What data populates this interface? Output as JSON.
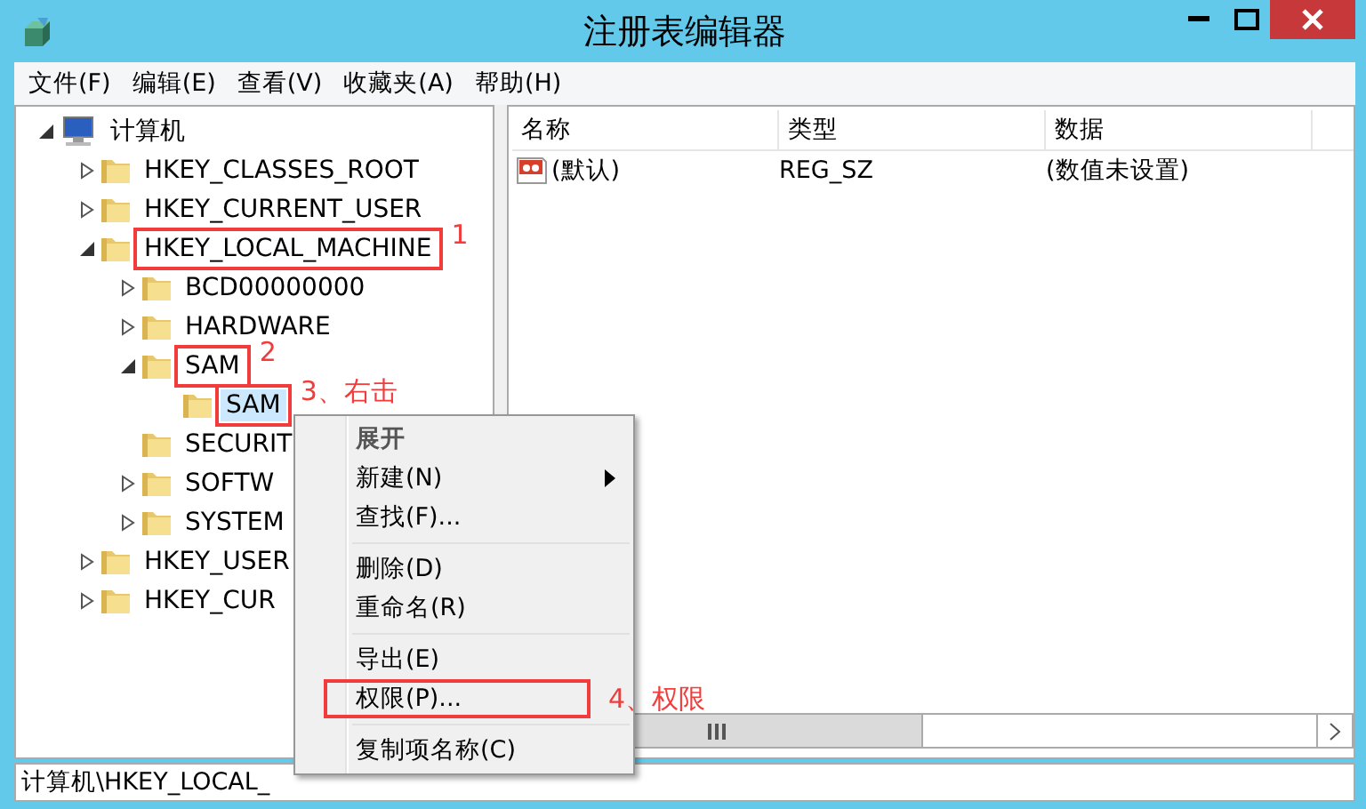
{
  "window": {
    "title": "注册表编辑器"
  },
  "menu_bar": [
    "文件(F)",
    "编辑(E)",
    "查看(V)",
    "收藏夹(A)",
    "帮助(H)"
  ],
  "tree": [
    {
      "label": "计算机",
      "kind": "computer",
      "expanded": true,
      "selected": false,
      "children": [
        {
          "label": "HKEY_CLASSES_ROOT",
          "kind": "folder",
          "expanded": false,
          "selected": false
        },
        {
          "label": "HKEY_CURRENT_USER",
          "kind": "folder",
          "expanded": false,
          "selected": false
        },
        {
          "label": "HKEY_LOCAL_MACHINE",
          "kind": "folder",
          "expanded": true,
          "selected": false,
          "annotation": "1",
          "children": [
            {
              "label": "BCD00000000",
              "kind": "folder",
              "expanded": false,
              "selected": false
            },
            {
              "label": "HARDWARE",
              "kind": "folder",
              "expanded": false,
              "selected": false
            },
            {
              "label": "SAM",
              "kind": "folder",
              "expanded": true,
              "selected": false,
              "annotation": "2",
              "children": [
                {
                  "label": "SAM",
                  "kind": "folder",
                  "selected": true,
                  "annotation": "3、右击"
                }
              ]
            },
            {
              "label": "SECURIT",
              "kind": "folder",
              "selected": false
            },
            {
              "label": "SOFTW",
              "kind": "folder",
              "expanded": false,
              "selected": false
            },
            {
              "label": "SYSTEM",
              "kind": "folder",
              "expanded": false,
              "selected": false
            }
          ]
        },
        {
          "label": "HKEY_USER",
          "kind": "folder",
          "expanded": false,
          "selected": false
        },
        {
          "label": "HKEY_CUR",
          "kind": "folder",
          "expanded": false,
          "selected": false
        }
      ]
    }
  ],
  "values": {
    "columns": [
      "名称",
      "类型",
      "数据"
    ],
    "rows": [
      {
        "name": "(默认)",
        "type": "REG_SZ",
        "data": "(数值未设置)"
      }
    ]
  },
  "context_menu": [
    {
      "kind": "item",
      "label": "展开",
      "default": true,
      "submenu": false
    },
    {
      "kind": "item",
      "label": "新建(N)",
      "default": false,
      "submenu": true
    },
    {
      "kind": "item",
      "label": "查找(F)...",
      "default": false,
      "submenu": false
    },
    {
      "kind": "separator"
    },
    {
      "kind": "item",
      "label": "删除(D)",
      "default": false,
      "submenu": false
    },
    {
      "kind": "item",
      "label": "重命名(R)",
      "default": false,
      "submenu": false
    },
    {
      "kind": "separator"
    },
    {
      "kind": "item",
      "label": "导出(E)",
      "default": false,
      "submenu": false
    },
    {
      "kind": "item",
      "label": "权限(P)...",
      "default": false,
      "submenu": false,
      "annotation": "4、权限"
    },
    {
      "kind": "separator"
    },
    {
      "kind": "item",
      "label": "复制项名称(C)",
      "default": false,
      "submenu": false
    }
  ],
  "status_bar": "计算机\\HKEY_LOCAL_"
}
